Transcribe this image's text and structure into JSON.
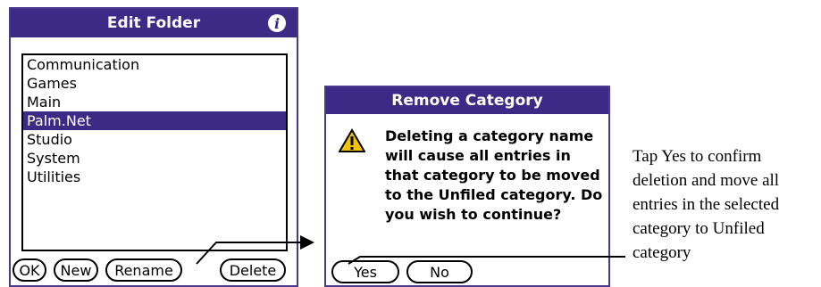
{
  "edit_folder": {
    "title": "Edit Folder",
    "info_icon": "info-icon",
    "categories": [
      {
        "label": "Communication",
        "selected": false
      },
      {
        "label": "Games",
        "selected": false
      },
      {
        "label": "Main",
        "selected": false
      },
      {
        "label": "Palm.Net",
        "selected": true
      },
      {
        "label": "Studio",
        "selected": false
      },
      {
        "label": "System",
        "selected": false
      },
      {
        "label": "Utilities",
        "selected": false
      }
    ],
    "buttons": {
      "ok": "OK",
      "new": "New",
      "rename": "Rename",
      "delete": "Delete"
    }
  },
  "remove_category": {
    "title": "Remove Category",
    "icon": "warning-icon",
    "message": "Deleting a category name will cause all entries in that category to be moved to the Unfiled category.  Do you wish to continue?",
    "buttons": {
      "yes": "Yes",
      "no": "No"
    }
  },
  "caption": "Tap Yes to confirm deletion and move all entries in the selected category to Unfiled category",
  "colors": {
    "title_bar": "#3b2b86",
    "selection": "#3b2b86",
    "border": "#4a3a8c"
  }
}
